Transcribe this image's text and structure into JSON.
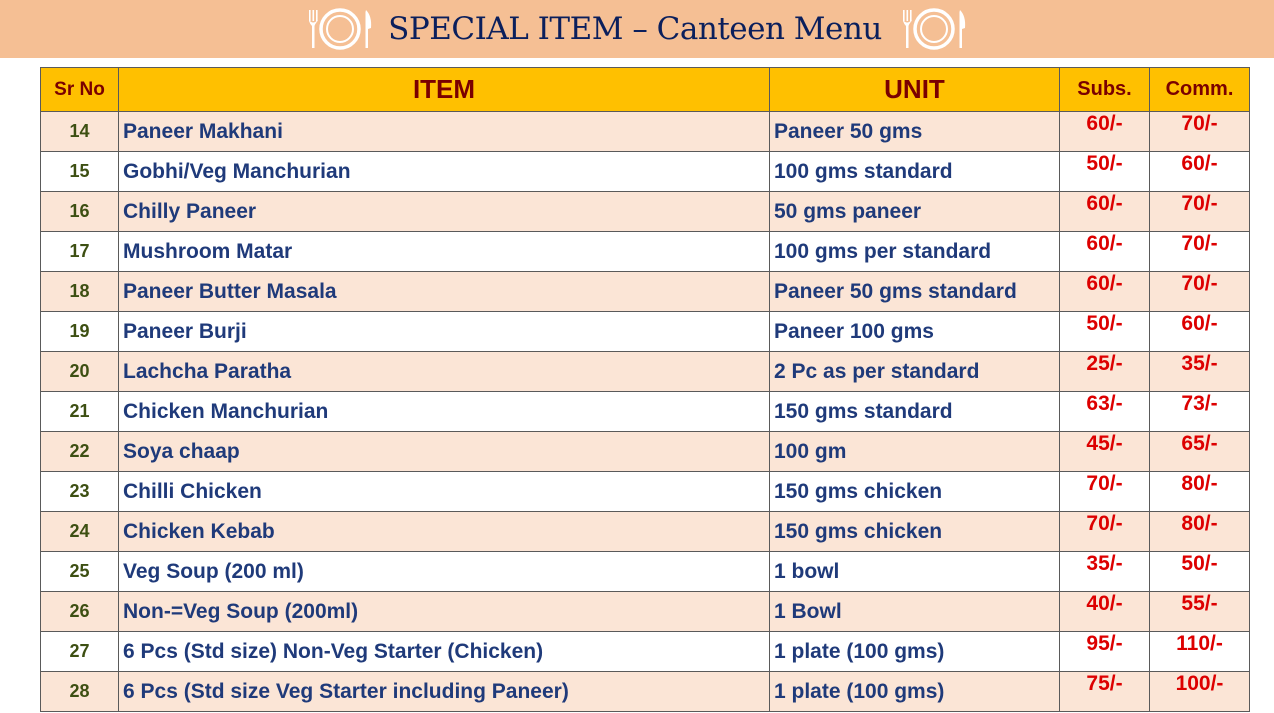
{
  "header": {
    "title": "SPECIAL ITEM – Canteen Menu",
    "icon": "plate-cutlery-icon",
    "background": "#f5bf94"
  },
  "table": {
    "columns": [
      "Sr No",
      "ITEM",
      "UNIT",
      "Subs.",
      "Comm."
    ],
    "header_color": "#ffc000",
    "rows": [
      {
        "sr": "14",
        "item": "Paneer Makhani",
        "unit": "Paneer 50 gms",
        "subs": "60/-",
        "comm": "70/-"
      },
      {
        "sr": "15",
        "item": "Gobhi/Veg  Manchurian",
        "unit": "100 gms standard",
        "subs": "50/-",
        "comm": "60/-"
      },
      {
        "sr": "16",
        "item": "Chilly Paneer",
        "unit": "50 gms paneer",
        "subs": "60/-",
        "comm": "70/-"
      },
      {
        "sr": "17",
        "item": "Mushroom Matar",
        "unit": "100 gms per standard",
        "subs": "60/-",
        "comm": "70/-"
      },
      {
        "sr": "18",
        "item": "Paneer Butter Masala",
        "unit": "Paneer 50 gms standard",
        "subs": "60/-",
        "comm": "70/-"
      },
      {
        "sr": "19",
        "item": "Paneer Burji",
        "unit": "Paneer 100 gms",
        "subs": "50/-",
        "comm": "60/-"
      },
      {
        "sr": "20",
        "item": "Lachcha Paratha",
        "unit": "2 Pc as per standard",
        "subs": "25/-",
        "comm": "35/-"
      },
      {
        "sr": "21",
        "item": "Chicken Manchurian",
        "unit": "150 gms standard",
        "subs": "63/-",
        "comm": "73/-"
      },
      {
        "sr": "22",
        "item": "Soya chaap",
        "unit": "100 gm",
        "subs": "45/-",
        "comm": "65/-"
      },
      {
        "sr": "23",
        "item": "Chilli Chicken",
        "unit": "150 gms chicken",
        "subs": "70/-",
        "comm": "80/-"
      },
      {
        "sr": "24",
        "item": "Chicken Kebab",
        "unit": "150 gms chicken",
        "subs": "70/-",
        "comm": "80/-"
      },
      {
        "sr": "25",
        "item": "Veg Soup (200 ml)",
        "unit": "1 bowl",
        "subs": "35/-",
        "comm": "50/-"
      },
      {
        "sr": "26",
        "item": "Non-=Veg Soup (200ml)",
        "unit": "1 Bowl",
        "subs": "40/-",
        "comm": "55/-"
      },
      {
        "sr": "27",
        "item": "6 Pcs (Std size) Non-Veg Starter (Chicken)",
        "unit": "1 plate (100 gms)",
        "subs": "95/-",
        "comm": "110/-"
      },
      {
        "sr": "28",
        "item": "6 Pcs (Std size Veg Starter including Paneer)",
        "unit": "1 plate (100 gms)",
        "subs": "75/-",
        "comm": "100/-"
      }
    ]
  }
}
